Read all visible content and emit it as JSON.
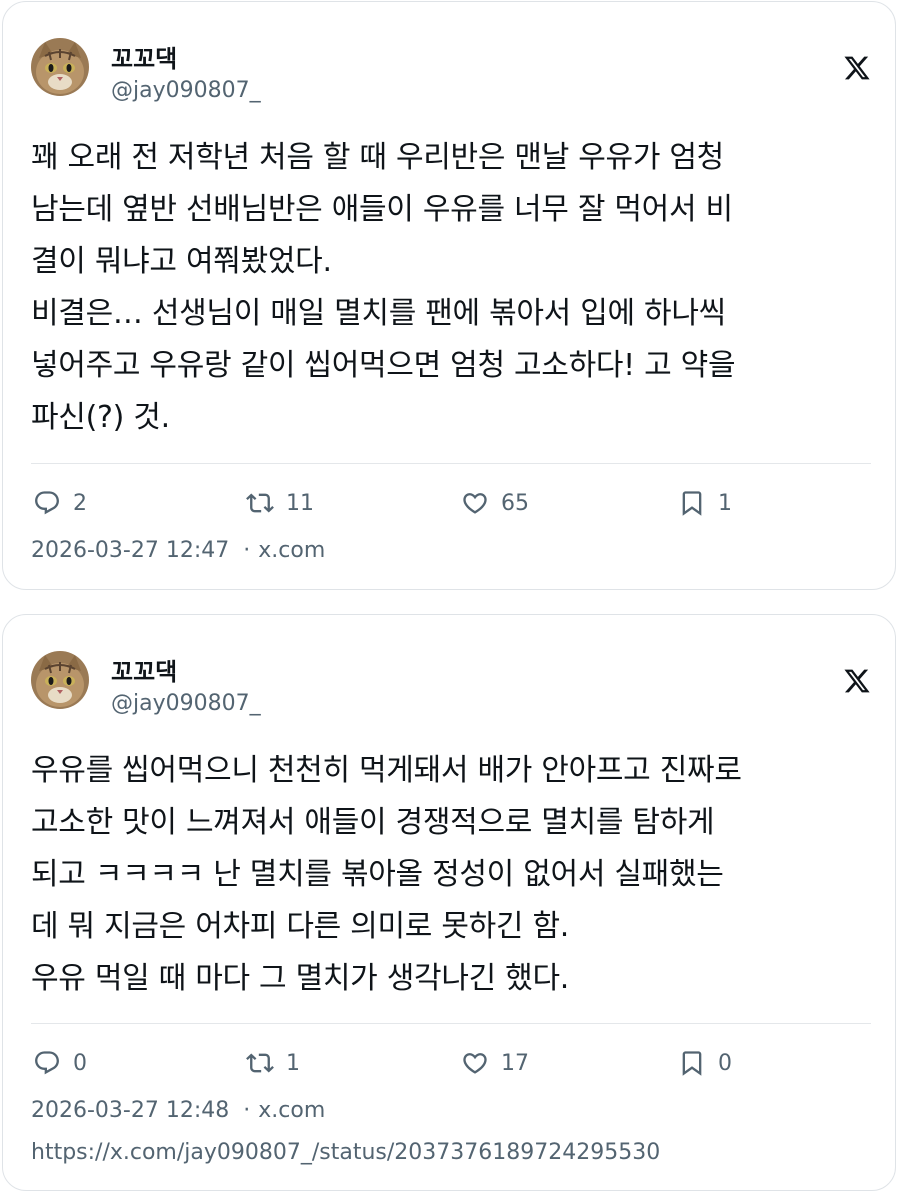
{
  "tweets": [
    {
      "display_name": "꼬꼬댁",
      "handle": "@jay090807_",
      "text_lines": [
        "꽤 오래 전 저학년 처음 할 때 우리반은 맨날 우유가 엄청",
        "남는데 옆반 선배님반은 애들이 우유를 너무 잘 먹어서 비",
        "결이 뭐냐고 여쭤봤었다.",
        "비결은… 선생님이 매일 멸치를 팬에 볶아서 입에 하나씩",
        "넣어주고 우유랑 같이 씹어먹으면 엄청 고소하다! 고 약을",
        "파신(?) 것."
      ],
      "replies": "2",
      "retweets": "11",
      "likes": "65",
      "bookmarks": "1",
      "timestamp": "2026-03-27 12:47",
      "source": "x.com",
      "icons": {
        "avatar": "cat-avatar",
        "platform": "x-logo-icon",
        "reply": "reply-icon",
        "retweet": "retweet-icon",
        "like": "heart-icon",
        "bookmark": "bookmark-icon"
      }
    },
    {
      "display_name": "꼬꼬댁",
      "handle": "@jay090807_",
      "text_lines": [
        "우유를 씹어먹으니 천천히 먹게돼서 배가 안아프고 진짜로",
        "고소한 맛이 느껴져서 애들이 경쟁적으로 멸치를 탐하게",
        "되고 ㅋㅋㅋㅋ 난 멸치를 볶아올 정성이 없어서 실패했는",
        "데 뭐 지금은 어차피 다른 의미로 못하긴 함.",
        "우유 먹일 때 마다 그 멸치가 생각나긴 했다."
      ],
      "replies": "0",
      "retweets": "1",
      "likes": "17",
      "bookmarks": "0",
      "timestamp": "2026-03-27 12:48",
      "source": "x.com",
      "url": "https://x.com/jay090807_/status/2037376189724295530",
      "icons": {
        "avatar": "cat-avatar",
        "platform": "x-logo-icon",
        "reply": "reply-icon",
        "retweet": "retweet-icon",
        "like": "heart-icon",
        "bookmark": "bookmark-icon"
      }
    }
  ],
  "colors": {
    "text": "#0f1419",
    "muted": "#536471",
    "border": "#dfe3e7"
  },
  "separator": "·"
}
